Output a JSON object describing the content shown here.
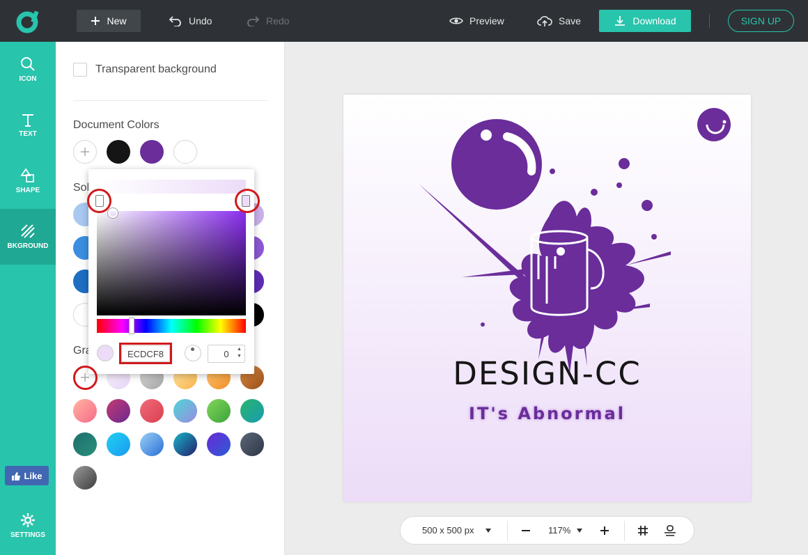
{
  "toolbar": {
    "new_label": "New",
    "undo_label": "Undo",
    "redo_label": "Redo",
    "preview_label": "Preview",
    "save_label": "Save",
    "download_label": "Download",
    "signup_label": "SIGN UP"
  },
  "rail": {
    "items": [
      {
        "label": "ICON",
        "icon": "search-icon"
      },
      {
        "label": "TEXT",
        "icon": "text-icon"
      },
      {
        "label": "SHAPE",
        "icon": "shape-icon"
      },
      {
        "label": "BKGROUND",
        "icon": "background-icon"
      }
    ],
    "like_label": "Like",
    "settings_label": "SETTINGS"
  },
  "panel": {
    "transparent_label": "Transparent background",
    "document_colors_title": "Document Colors",
    "document_colors": [
      "#151515",
      "#6a2d9a",
      "#ffffff"
    ],
    "solid_title_visible": "Sol",
    "gradient_title_visible": "Gra",
    "solid_left_column": [
      "#a9c8f0",
      "#3b8ee0",
      "#1e6ec2",
      "#ffffff"
    ],
    "solid_right_column": [
      "#c9b0e8",
      "#8b57d3",
      "#5e2bb5",
      "#000000"
    ],
    "gradient_rows": [
      [
        {
          "from": "#f6eefc",
          "to": "#e6d6f5"
        },
        {
          "from": "#d8d8d8",
          "to": "#a5a5a5"
        },
        {
          "from": "#ffe2a3",
          "to": "#f7b54d"
        },
        {
          "from": "#ffc56e",
          "to": "#ef8e2a"
        },
        {
          "from": "#d98c43",
          "to": "#9a4d18"
        }
      ],
      [
        {
          "from": "#ffb3a0",
          "to": "#f76b8a"
        },
        {
          "from": "#c43a74",
          "to": "#6b2a8f"
        },
        {
          "from": "#f06a7a",
          "to": "#d9404f"
        },
        {
          "from": "#4dd6d6",
          "to": "#9a8be0"
        },
        {
          "from": "#82d65a",
          "to": "#3aa33a"
        },
        {
          "from": "#27b56e",
          "to": "#1a9bb0"
        }
      ],
      [
        {
          "from": "#1d6e6e",
          "to": "#2b8f7a"
        },
        {
          "from": "#21d0f2",
          "to": "#1a9bf0"
        },
        {
          "from": "#9cd0f5",
          "to": "#2a6fd6"
        },
        {
          "from": "#19b5c9",
          "to": "#231e6b"
        },
        {
          "from": "#6a2bd6",
          "to": "#2b5bd6"
        },
        {
          "from": "#5a6678",
          "to": "#2f3745"
        }
      ],
      [
        {
          "from": "#9a9a9a",
          "to": "#3d3d3d"
        }
      ]
    ]
  },
  "picker": {
    "hex_value": "ECDCF8",
    "angle_value": "0",
    "stop_start_color": "#ffffff",
    "stop_end_color": "#ecdcf8"
  },
  "canvas": {
    "brand_text": "DESIGN-CC",
    "tagline_text": "IT's Abnormal",
    "brand_color": "#6a2d9a"
  },
  "zoombar": {
    "size_label": "500 x 500 px",
    "zoom_label": "117%"
  }
}
